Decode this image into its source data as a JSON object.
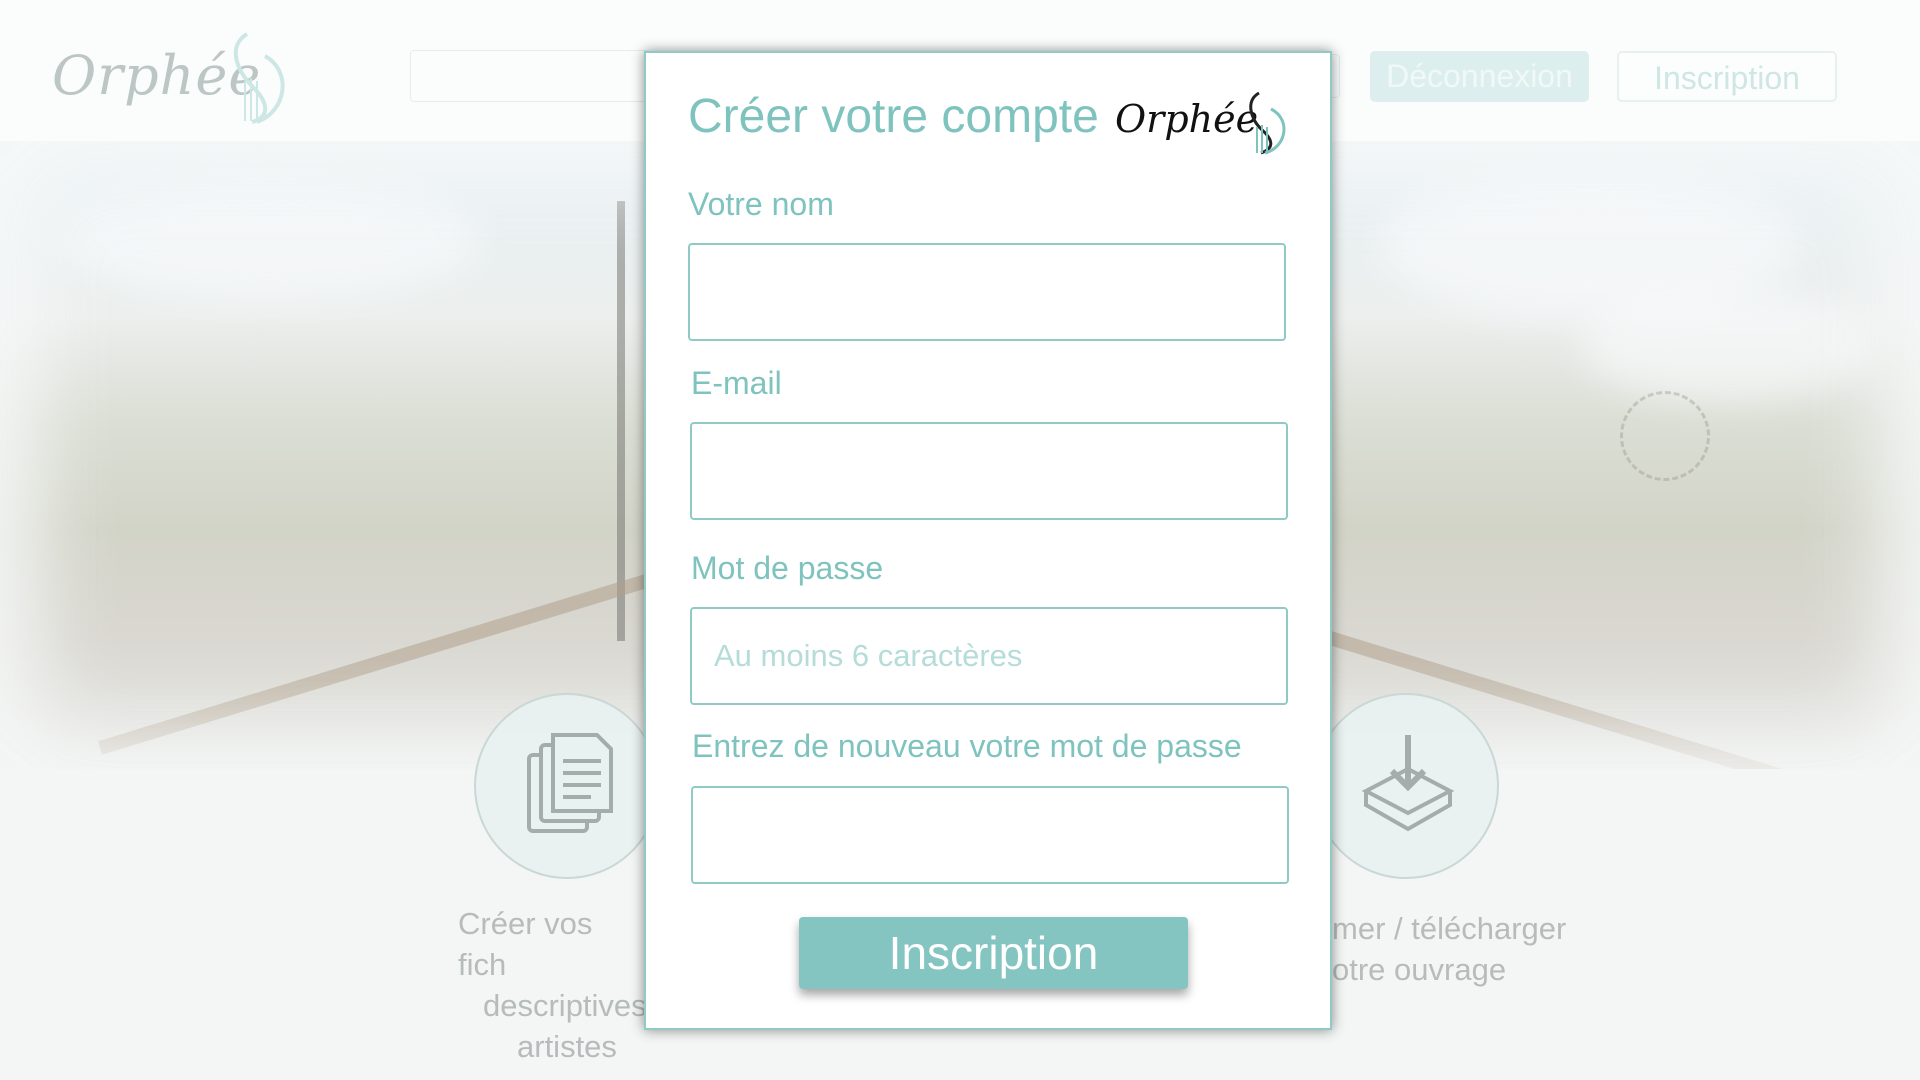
{
  "background": {
    "header": {
      "logo_text": "Orphée",
      "search_placeholder": "",
      "deconnexion_label": "Déconnexion",
      "inscription_label": "Inscription"
    },
    "features": [
      {
        "icon": "documents-icon",
        "text_line1": "Créer vos fich",
        "text_line2": "descriptives",
        "text_line3": "artistes"
      },
      {
        "icon": "download-tray-icon",
        "text_line1": "mer / télécharger",
        "text_line2": "otre ouvrage"
      }
    ]
  },
  "modal": {
    "title": "Créer votre compte",
    "logo_text": "Orphée",
    "fields": {
      "name": {
        "label": "Votre nom",
        "value": "",
        "placeholder": ""
      },
      "email": {
        "label": "E-mail",
        "value": "",
        "placeholder": ""
      },
      "password": {
        "label": "Mot de passe",
        "value": "",
        "placeholder": "Au moins 6 caractères"
      },
      "password_confirm": {
        "label": "Entrez de nouveau votre mot de passe",
        "value": "",
        "placeholder": ""
      }
    },
    "submit_label": "Inscription"
  },
  "colors": {
    "accent": "#84c5c1",
    "accent_text": "#7fc3bf",
    "border": "#8fcac6",
    "modal_bg": "#ffffff"
  }
}
